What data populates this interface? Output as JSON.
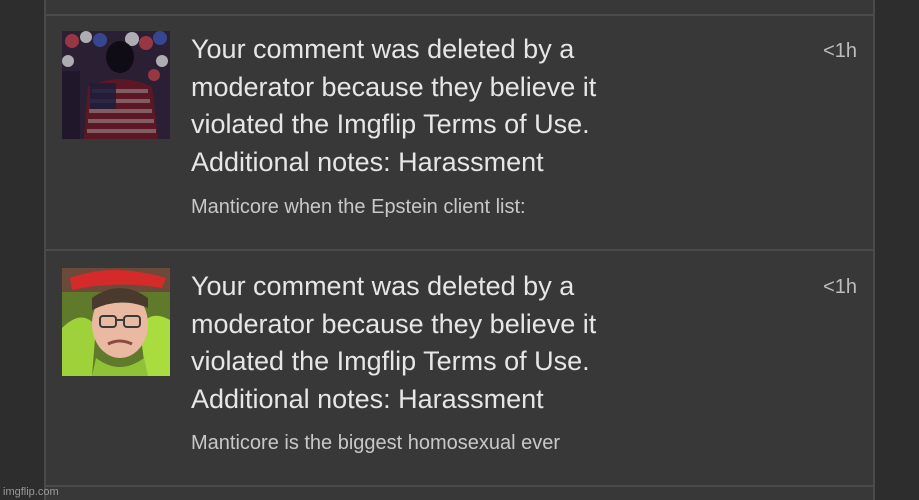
{
  "notifications": [
    {
      "message_lines": [
        "Your comment was deleted by a",
        "moderator because they believe it",
        "violated the Imgflip Terms of Use.",
        "Additional notes: Harassment"
      ],
      "comment": "Manticore when the Epstein client list:",
      "time": "<1h",
      "thumbnail": "silhouette-flag-image"
    },
    {
      "message_lines": [
        "Your comment was deleted by a",
        "moderator because they believe it",
        "violated the Imgflip Terms of Use.",
        "Additional notes: Harassment"
      ],
      "comment": "Manticore is the biggest homosexual ever",
      "time": "<1h",
      "thumbnail": "crying-man-image"
    }
  ],
  "watermark": "imgflip.com",
  "colors": {
    "background": "#2d2d2d",
    "panel": "#383838",
    "divider": "#4b4b4b",
    "text": "#e6e6e6",
    "muted": "#c8c8c8"
  }
}
